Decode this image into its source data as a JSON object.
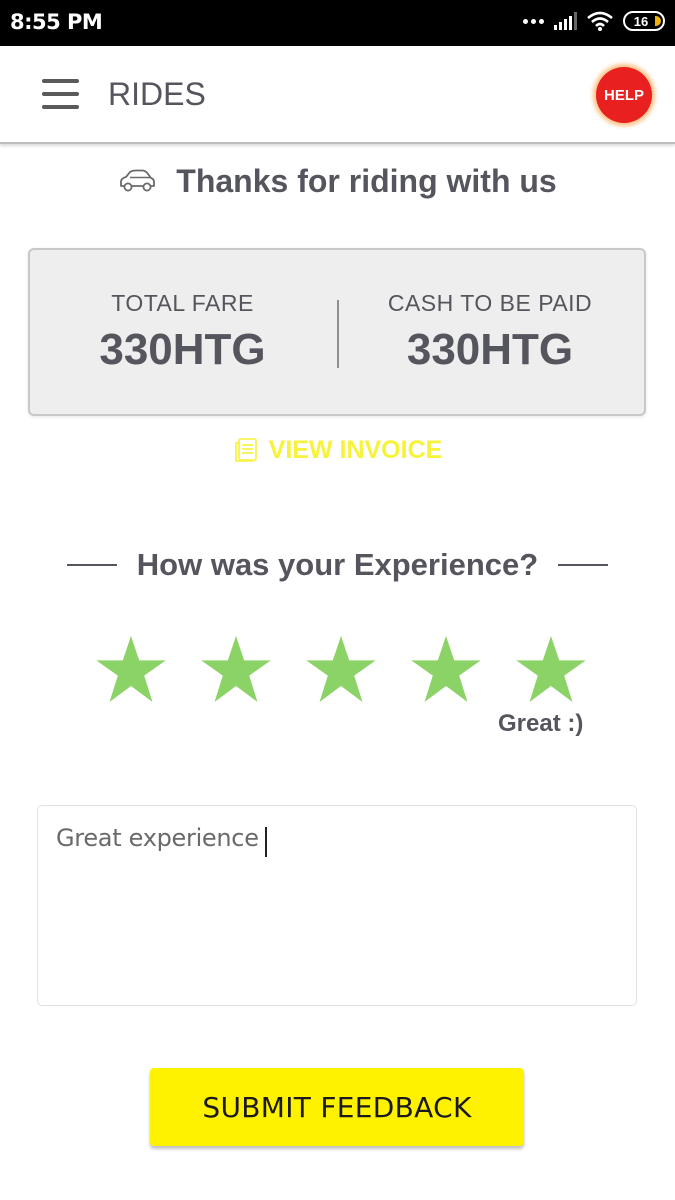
{
  "status_bar": {
    "time": "8:55 PM",
    "battery": "16",
    "icons": [
      "more-dots-icon",
      "signal-icon",
      "wifi-icon",
      "battery-icon"
    ]
  },
  "app_bar": {
    "menu_icon": "hamburger-menu-icon",
    "title": "RIDES",
    "help_label": "HELP"
  },
  "colors": {
    "help": "#e8201f",
    "invoice": "#f7f23a",
    "star": "#8cd367",
    "submit": "#fff200",
    "text": "#55555e"
  },
  "thanks": {
    "icon": "car-icon",
    "text": "Thanks for riding with us"
  },
  "fare": {
    "total_label": "TOTAL FARE",
    "total_value": "330HTG",
    "cash_label": "CASH TO BE PAID",
    "cash_value": "330HTG"
  },
  "invoice": {
    "icon": "invoice-icon",
    "label": "VIEW INVOICE"
  },
  "experience": {
    "title": "How was your Experience?",
    "rating": 5,
    "max_rating": 5,
    "rating_label": "Great :)"
  },
  "feedback": {
    "value": "Great experience"
  },
  "submit": {
    "label": "SUBMIT FEEDBACK"
  }
}
